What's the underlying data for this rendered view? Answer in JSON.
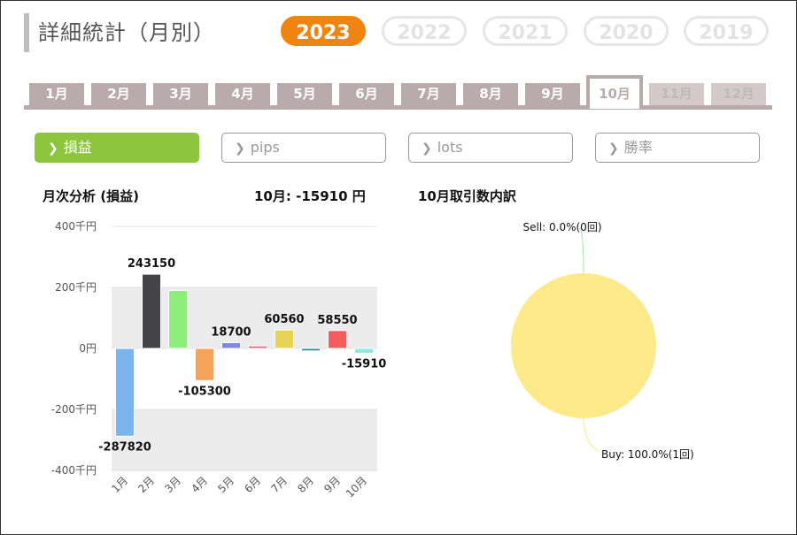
{
  "page": {
    "title": "詳細統計（月別）"
  },
  "years": [
    "2023",
    "2022",
    "2021",
    "2020",
    "2019"
  ],
  "active_year": "2023",
  "months": [
    "1月",
    "2月",
    "3月",
    "4月",
    "5月",
    "6月",
    "7月",
    "8月",
    "9月",
    "10月",
    "11月",
    "12月"
  ],
  "active_month": "10月",
  "metrics": [
    {
      "label": "損益",
      "active": true
    },
    {
      "label": "pips",
      "active": false
    },
    {
      "label": "lots",
      "active": false
    },
    {
      "label": "勝率",
      "active": false
    }
  ],
  "left_panel": {
    "title": "月次分析 (損益)",
    "summary": "10月:  -15910 円"
  },
  "right_panel": {
    "title": "10月取引数内訳"
  },
  "colors": {
    "accent": "#f08410",
    "green": "#8cc63f",
    "tab": "#b9abab"
  },
  "chart_data": [
    {
      "type": "bar",
      "categories": [
        "1月",
        "2月",
        "3月",
        "4月",
        "5月",
        "6月",
        "7月",
        "8月",
        "9月",
        "10月"
      ],
      "values": [
        -287820,
        243150,
        190000,
        -105300,
        18700,
        8000,
        60560,
        -8000,
        58550,
        -15910
      ],
      "labels": [
        "-287820",
        "243150",
        "",
        "-105300",
        "18700",
        "",
        "60560",
        "",
        "58550",
        "-15910"
      ],
      "colors": [
        "#7cb5ec",
        "#434348",
        "#90ed7d",
        "#f7a35c",
        "#8085e9",
        "#f15c80",
        "#e4d354",
        "#2b908f",
        "#f45b5b",
        "#91e8e1"
      ],
      "yticks": [
        "400千円",
        "200千円",
        "0円",
        "-200千円",
        "-400千円"
      ],
      "ylim": [
        -400000,
        400000
      ]
    },
    {
      "type": "pie",
      "slices": [
        {
          "name": "Sell",
          "value": 0,
          "label": "Sell: 0.0%(0回)"
        },
        {
          "name": "Buy",
          "value": 100,
          "label": "Buy: 100.0%(1回)"
        }
      ],
      "colors": [
        "#a5e6a0",
        "#fbe98a"
      ]
    }
  ]
}
